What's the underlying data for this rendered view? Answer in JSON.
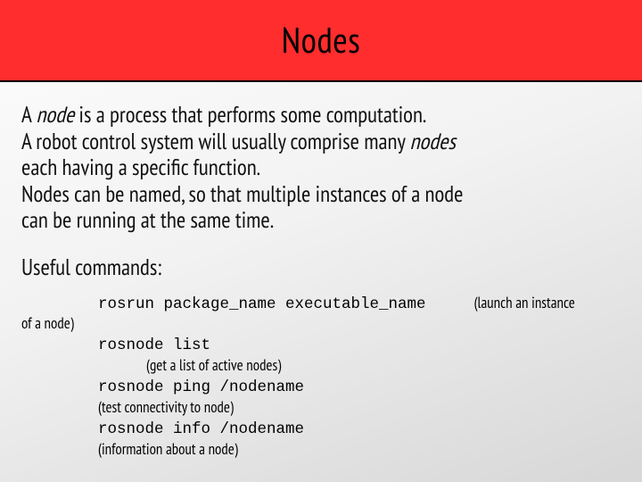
{
  "header": {
    "title": "Nodes"
  },
  "body": {
    "p1a": "A ",
    "p1_em": "node",
    "p1b": " is a process that performs some computation.",
    "p2a": "A robot control system will usually comprise many ",
    "p2_em": "nodes",
    "p3": "each having a specific function.",
    "p4": "Nodes can be named, so that multiple instances of a node",
    "p5": "can be running at the same time.",
    "subhead": "Useful commands:",
    "cmd1": "rosrun package_name executable_name",
    "cmd1_annot_r": "(launch an instance",
    "cmd1_annot_l": "of a node)",
    "cmd2": "rosnode list",
    "cmd2_annot": "(get a list of active nodes)",
    "cmd3": "rosnode ping /nodename",
    "cmd3_annot": "(test connectivity to node)",
    "cmd4": "rosnode info /nodename",
    "cmd4_annot": "(information about a node)"
  }
}
